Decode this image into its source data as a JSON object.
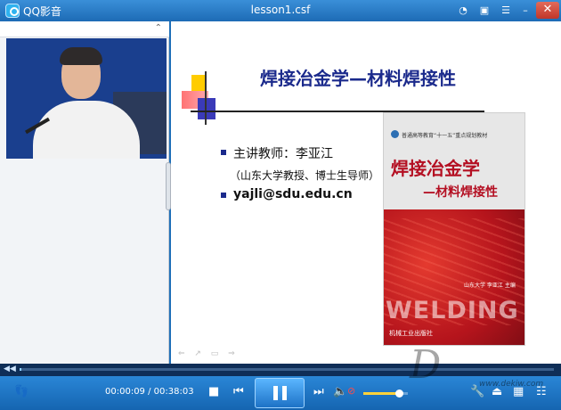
{
  "window": {
    "app_name": "QQ影音",
    "file_name": "lesson1.csf"
  },
  "left_panel": {
    "collapse_glyph": "⌃"
  },
  "slide": {
    "title": "焊接冶金学—材料焊接性",
    "line1": "主讲教师：李亚江",
    "line2": "（山东大学教授、博士生导师）",
    "line3": "yajli@sdu.edu.cn",
    "nav_glyphs": "⇐ ↗ ▭ ⇒"
  },
  "book": {
    "series": "普通高等教育“十一五”重点规划教材",
    "title": "焊接冶金学",
    "subtitle": "—材料焊接性",
    "author": "山东大学  李亚江  主编",
    "welding": "WELDING",
    "publisher": "机械工业出版社"
  },
  "playback": {
    "time_display": "00:00:09 / 00:38:03",
    "progress_fraction": 0.004,
    "volume_fraction": 0.8
  },
  "watermark": {
    "text": "D",
    "url": "www.dekiw.com"
  },
  "colors": {
    "title_blue": "#1b2a8c",
    "book_red": "#b40f22",
    "control_blue": "#1565b1"
  }
}
